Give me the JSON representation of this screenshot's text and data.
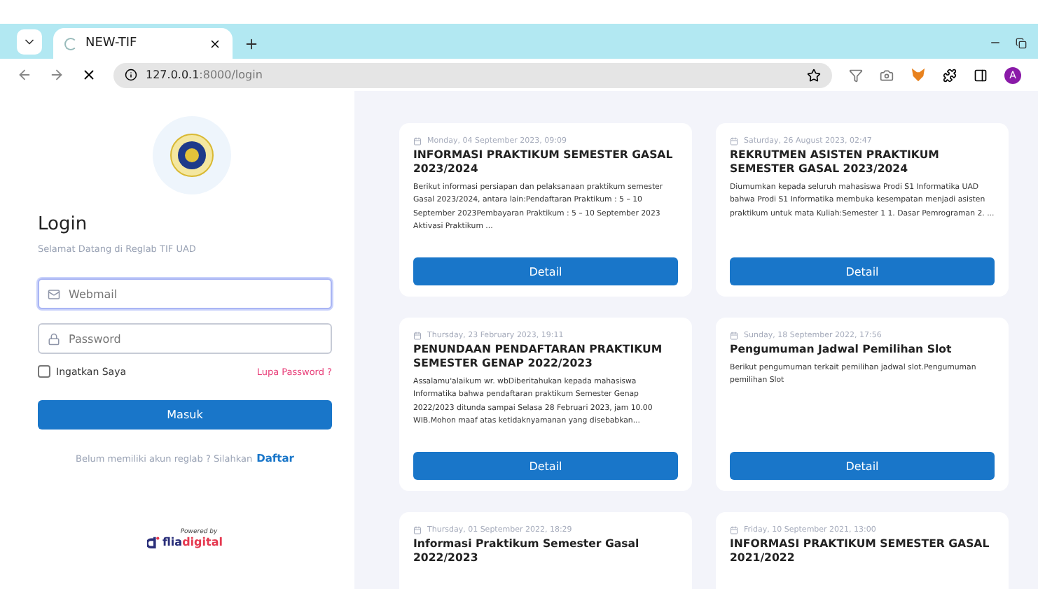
{
  "browser": {
    "tab_title": "NEW-TIF",
    "tab_loading": true,
    "url_host": "127.0.0.1",
    "url_path": ":8000/login",
    "profile_initial": "A"
  },
  "login": {
    "title": "Login",
    "subtitle": "Selamat Datang di Reglab TIF UAD",
    "email_placeholder": "Webmail",
    "email_focused": true,
    "password_placeholder": "Password",
    "remember": {
      "label": "Ingatkan Saya",
      "checked": false
    },
    "forgot": "Lupa Password ?",
    "submit": "Masuk",
    "signup_prompt": "Belum memiliki akun reglab ? Silahkan",
    "signup_link": "Daftar",
    "powered_by": "Powered by",
    "brand_a": "flia",
    "brand_b": "digital"
  },
  "cards": [
    {
      "date": "Monday, 04 September 2023, 09:09",
      "title": "INFORMASI PRAKTIKUM SEMESTER GASAL 2023/2024",
      "body": "Berikut informasi persiapan dan pelaksanaan praktikum semester Gasal 2023/2024, antara lain:Pendaftaran Praktikum : 5 – 10 September 2023Pembayaran Praktikum : 5 – 10 September 2023  Aktivasi Praktikum  ...",
      "button": "Detail"
    },
    {
      "date": "Saturday, 26 August 2023, 02:47",
      "title": "REKRUTMEN ASISTEN PRAKTIKUM SEMESTER GASAL 2023/2024",
      "body": "Diumumkan kepada seluruh mahasiswa Prodi S1 Informatika UAD bahwa Prodi S1 Informatika membuka kesempatan menjadi asisten praktikum untuk mata Kuliah:Semester 1 1. Dasar Pemrograman 2.  ...",
      "button": "Detail"
    },
    {
      "date": "Thursday, 23 February 2023, 19:11",
      "title": "PENUNDAAN PENDAFTARAN PRAKTIKUM SEMESTER GENAP 2022/2023",
      "body": "Assalamu'alaikum wr. wbDiberitahukan kepada mahasiswa Informatika bahwa pendaftaran praktikum Semester Genap 2022/2023 ditunda sampai Selasa 28 Februari 2023, jam 10.00 WIB.Mohon maaf atas ketidaknyamanan yang disebabkan...",
      "button": "Detail"
    },
    {
      "date": "Sunday, 18 September 2022, 17:56",
      "title": "Pengumuman Jadwal Pemilihan Slot",
      "body": "Berikut pengumuman terkait pemilihan jadwal slot.Pengumuman pemilihan Slot",
      "button": "Detail"
    },
    {
      "date": "Thursday, 01 September 2022, 18:29",
      "title": "Informasi Praktikum Semester Gasal 2022/2023"
    },
    {
      "date": "Friday, 10 September 2021, 13:00",
      "title": "INFORMASI PRAKTIKUM SEMESTER GASAL 2021/2022"
    }
  ]
}
